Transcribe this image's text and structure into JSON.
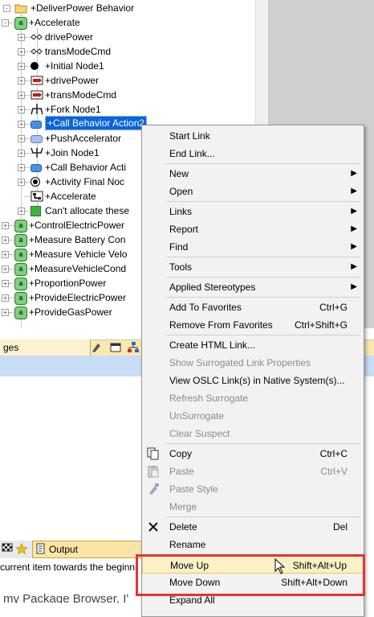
{
  "tree": {
    "items": [
      {
        "label": "+DeliverPower Behavior",
        "icon": "folder-icon"
      },
      {
        "label": "+Accelerate",
        "icon": "activity-icon"
      },
      {
        "label": "drivePower",
        "icon": "parameter-icon"
      },
      {
        "label": "transModeCmd",
        "icon": "parameter-icon"
      },
      {
        "label": "+Initial Node1",
        "icon": "initial-node-icon"
      },
      {
        "label": "+drivePower",
        "icon": "pin-icon"
      },
      {
        "label": "+transModeCmd",
        "icon": "pin-icon"
      },
      {
        "label": "+Fork Node1",
        "icon": "fork-node-icon"
      },
      {
        "label": "+Call Behavior Action2",
        "icon": "call-behavior-icon"
      },
      {
        "label": "+PushAccelerator",
        "icon": "action-icon"
      },
      {
        "label": "+Join Node1",
        "icon": "join-node-icon"
      },
      {
        "label": "+Call Behavior Acti",
        "icon": "call-behavior-icon"
      },
      {
        "label": "+Activity Final Noc",
        "icon": "final-node-icon"
      },
      {
        "label": "+Accelerate",
        "icon": "diagram-icon"
      },
      {
        "label": "Can't allocate these",
        "icon": "note-icon"
      },
      {
        "label": "+ControlElectricPower",
        "icon": "activity-icon"
      },
      {
        "label": "+Measure Battery Con",
        "icon": "activity-icon"
      },
      {
        "label": "+Measure Vehicle Velo",
        "icon": "activity-icon"
      },
      {
        "label": "+MeasureVehicleCond",
        "icon": "activity-icon"
      },
      {
        "label": "+ProportionPower",
        "icon": "activity-icon"
      },
      {
        "label": "+ProvideElectricPower",
        "icon": "activity-icon"
      },
      {
        "label": "+ProvideGasPower",
        "icon": "activity-icon"
      }
    ]
  },
  "panels": {
    "tab_ges": "ges",
    "tab_output": "Output",
    "status_text": "current item towards the beginni",
    "bottom_text": "my Package Browser, I'"
  },
  "menu": {
    "groups": [
      [
        {
          "label": "Start Link"
        },
        {
          "label": "End Link..."
        }
      ],
      [
        {
          "label": "New",
          "submenu": true
        },
        {
          "label": "Open",
          "submenu": true
        }
      ],
      [
        {
          "label": "Links",
          "submenu": true
        },
        {
          "label": "Report",
          "submenu": true
        },
        {
          "label": "Find",
          "submenu": true
        }
      ],
      [
        {
          "label": "Tools",
          "submenu": true
        }
      ],
      [
        {
          "label": "Applied Stereotypes",
          "submenu": true
        }
      ],
      [
        {
          "label": "Add To Favorites",
          "shortcut": "Ctrl+G"
        },
        {
          "label": "Remove From Favorites",
          "shortcut": "Ctrl+Shift+G"
        }
      ],
      [
        {
          "label": "Create HTML Link..."
        },
        {
          "label": "Show Surrogated Link Properties",
          "disabled": true
        },
        {
          "label": "View OSLC Link(s) in Native System(s)..."
        },
        {
          "label": "Refresh Surrogate",
          "disabled": true
        },
        {
          "label": "UnSurrogate",
          "disabled": true
        },
        {
          "label": "Clear Suspect",
          "disabled": true
        }
      ],
      [
        {
          "label": "Copy",
          "shortcut": "Ctrl+C",
          "icon": "copy-icon"
        },
        {
          "label": "Paste",
          "shortcut": "Ctrl+V",
          "icon": "paste-icon",
          "disabled": true
        },
        {
          "label": "Paste Style",
          "icon": "paste-style-icon",
          "disabled": true
        },
        {
          "label": "Merge",
          "disabled": true
        }
      ],
      [
        {
          "label": "Delete",
          "shortcut": "Del",
          "icon": "delete-icon"
        },
        {
          "label": "Rename"
        }
      ],
      [
        {
          "label": "Move Up",
          "shortcut": "Shift+Alt+Up",
          "highlighted": true
        },
        {
          "label": "Move Down",
          "shortcut": "Shift+Alt+Down"
        },
        {
          "label": "Expand All"
        }
      ]
    ]
  },
  "colors": {
    "selection": "#0a64d8",
    "highlight": "#fdf0c5",
    "annotation_box": "#e53333"
  }
}
